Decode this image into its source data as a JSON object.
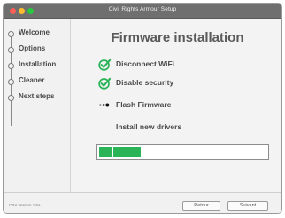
{
  "window": {
    "title": "Civil Rights Armour Setup"
  },
  "sidebar": {
    "steps": [
      {
        "label": "Welcome"
      },
      {
        "label": "Options"
      },
      {
        "label": "Installation"
      },
      {
        "label": "Cleaner"
      },
      {
        "label": "Next steps"
      }
    ]
  },
  "main": {
    "heading": "Firmware installation",
    "tasks": [
      {
        "label": "Disconnect WiFi",
        "status": "done",
        "icon": "check-circle-icon"
      },
      {
        "label": "Disable security",
        "status": "done",
        "icon": "check-circle-icon"
      },
      {
        "label": "Flash Firmware",
        "status": "in-progress",
        "icon": "spinner-dots-icon"
      },
      {
        "label": "Install new drivers",
        "status": "pending",
        "icon": ""
      }
    ],
    "progress": {
      "filled_segments": 3,
      "fraction": 0.25
    }
  },
  "footer": {
    "version": "CRA Version 1.5a",
    "back_label": "Retour",
    "next_label": "Suivant"
  },
  "colors": {
    "accent": "#2bb358",
    "titlebar": "#6f6f6f"
  }
}
